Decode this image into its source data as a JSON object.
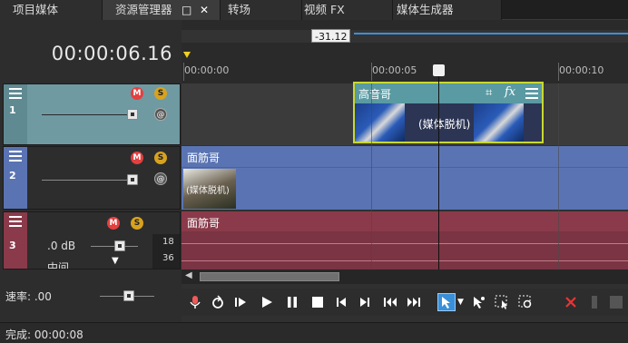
{
  "tabs": [
    {
      "label": "项目媒体"
    },
    {
      "label": "资源管理器"
    },
    {
      "label": "转场"
    },
    {
      "label": "视频 FX"
    },
    {
      "label": "媒体生成器"
    }
  ],
  "tab_controls": {
    "restore": "□",
    "close": "✕"
  },
  "timecode": "00:00:06.16",
  "marker_readout": "-31.12",
  "ruler": {
    "labels": [
      "00:00:00",
      "00:00:05",
      "00:00:10"
    ]
  },
  "tracks": [
    {
      "number": "1",
      "clips": [
        {
          "title": "高音哥",
          "overlay_text": "(媒体脱机)"
        }
      ]
    },
    {
      "number": "2",
      "clips": [
        {
          "title": "面筋哥",
          "overlay_text": "(媒体脱机)"
        }
      ]
    },
    {
      "number": "3",
      "volume": ".0 dB",
      "pan_label": "中间",
      "meter_ticks": [
        "18",
        "36"
      ],
      "clips": [
        {
          "title": "面筋哥"
        }
      ]
    }
  ],
  "rate": {
    "label": "速率: .00"
  },
  "status": {
    "text": "完成: 00:00:08"
  },
  "colors": {
    "track1_head": "#6f9aa2",
    "track1_lane": "#3b3b3b",
    "video_clip_header": "#5a9aa3",
    "video_clip_border": "#c8d92f",
    "track2": "#5a74b3",
    "track3": "#8a3a4a",
    "accent_blue": "#3a8fd9",
    "badge_m": "#e34040",
    "badge_s": "#d8a21e"
  },
  "icons": [
    "hamburger-icon",
    "mute-icon",
    "solo-icon",
    "composite-icon",
    "crop-icon",
    "fx-icon",
    "record-icon",
    "loop-icon",
    "play-from-start-icon",
    "play-icon",
    "pause-icon",
    "stop-icon",
    "prev-frame-icon",
    "next-frame-icon",
    "rewind-icon",
    "fast-forward-icon",
    "normal-edit-tool-icon",
    "envelope-tool-icon",
    "selection-tool-icon",
    "zoom-tool-icon",
    "delete-icon"
  ]
}
